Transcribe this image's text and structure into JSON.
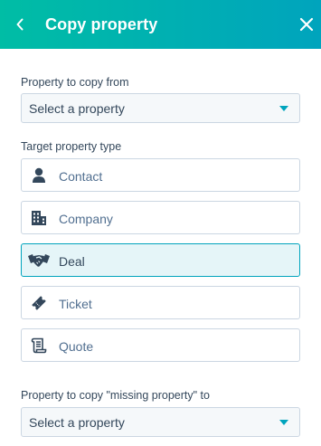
{
  "header": {
    "title": "Copy property",
    "back_icon": "chevron-left-icon",
    "close_icon": "close-icon",
    "gradient_start": "#00bda5",
    "gradient_end": "#00a4bd"
  },
  "copy_from": {
    "label": "Property to copy from",
    "select_value": "Select a property"
  },
  "target_type": {
    "label": "Target property type",
    "options": [
      {
        "label": "Contact",
        "icon": "contact-icon",
        "selected": false
      },
      {
        "label": "Company",
        "icon": "company-icon",
        "selected": false
      },
      {
        "label": "Deal",
        "icon": "deal-icon",
        "selected": true
      },
      {
        "label": "Ticket",
        "icon": "ticket-icon",
        "selected": false
      },
      {
        "label": "Quote",
        "icon": "quote-icon",
        "selected": false
      }
    ]
  },
  "missing_property": {
    "label": "Property to copy \"missing property\" to",
    "select_value": "Select a property"
  },
  "colors": {
    "accent": "#00a4bd",
    "text": "#33475b",
    "selected_bg": "#e5f5f8",
    "border": "#cbd6e2"
  }
}
